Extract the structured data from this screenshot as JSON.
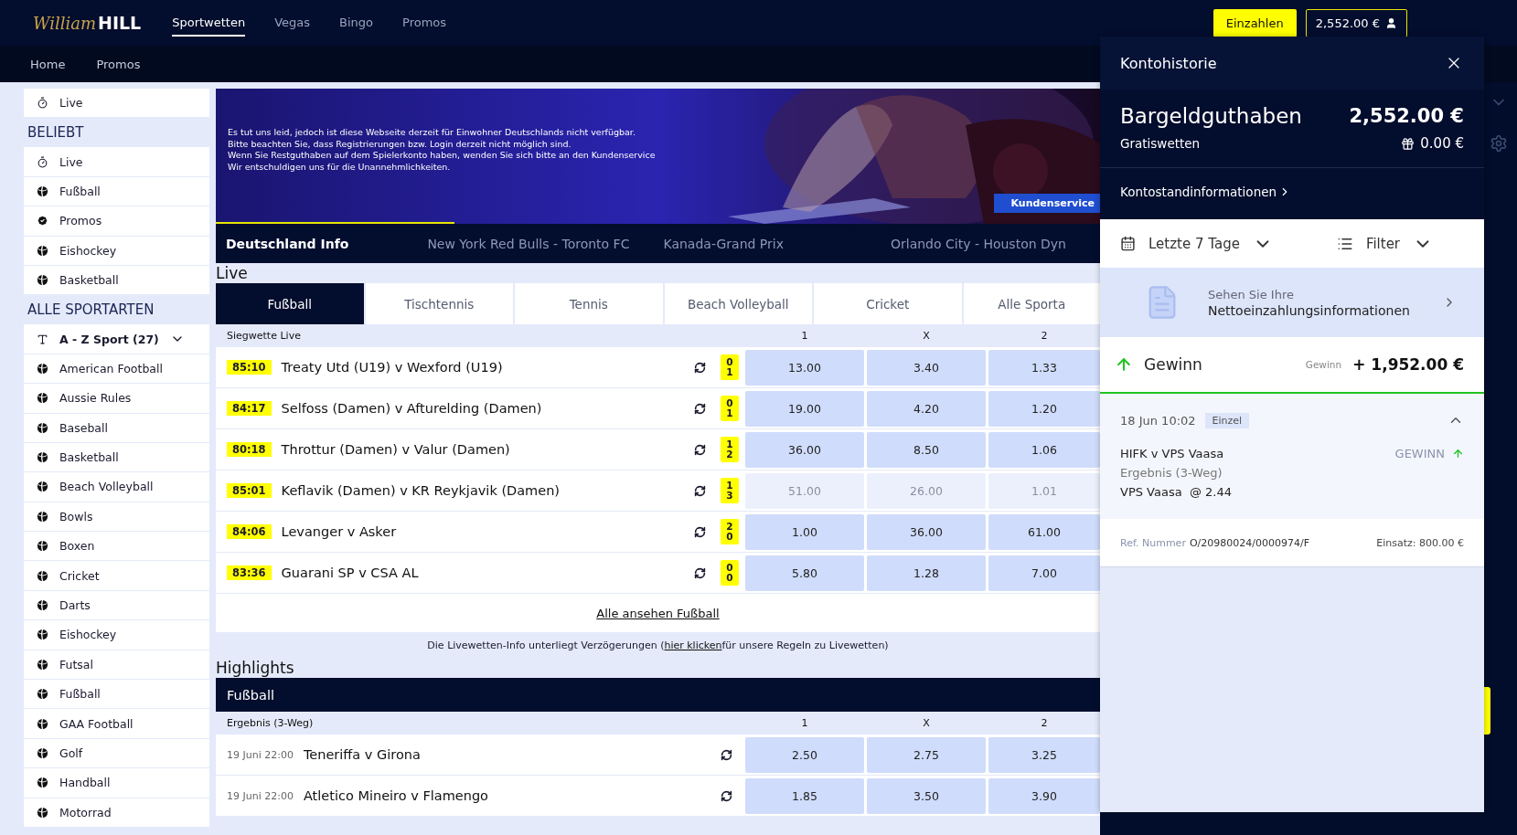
{
  "header": {
    "logo": {
      "script": "William",
      "bold": "HILL"
    },
    "nav": [
      {
        "label": "Sportwetten",
        "selected": true
      },
      {
        "label": "Vegas",
        "selected": false
      },
      {
        "label": "Bingo",
        "selected": false
      },
      {
        "label": "Promos",
        "selected": false
      }
    ],
    "deposit_button": "Einzahlen",
    "balance": "2,552.00 €"
  },
  "subnav": [
    {
      "label": "Home"
    },
    {
      "label": "Promos"
    }
  ],
  "sidebar": {
    "top": [
      {
        "label": "Live",
        "kind": "live"
      }
    ],
    "sections": [
      {
        "title": "BELIEBT",
        "items": [
          {
            "label": "Live",
            "kind": "live"
          },
          {
            "label": "Fußball",
            "kind": "sport"
          },
          {
            "label": "Promos",
            "kind": "promo"
          },
          {
            "label": "Eishockey",
            "kind": "sport"
          },
          {
            "label": "Basketball",
            "kind": "sport"
          }
        ]
      },
      {
        "title": "ALLE SPORTARTEN",
        "items": [
          {
            "label": "A - Z Sport (27)",
            "kind": "group"
          },
          {
            "label": "American Football",
            "kind": "sport"
          },
          {
            "label": "Aussie Rules",
            "kind": "sport"
          },
          {
            "label": "Baseball",
            "kind": "sport"
          },
          {
            "label": "Basketball",
            "kind": "sport"
          },
          {
            "label": "Beach Volleyball",
            "kind": "sport"
          },
          {
            "label": "Bowls",
            "kind": "sport"
          },
          {
            "label": "Boxen",
            "kind": "sport"
          },
          {
            "label": "Cricket",
            "kind": "sport"
          },
          {
            "label": "Darts",
            "kind": "sport"
          },
          {
            "label": "Eishockey",
            "kind": "sport"
          },
          {
            "label": "Futsal",
            "kind": "sport"
          },
          {
            "label": "Fußball",
            "kind": "sport"
          },
          {
            "label": "GAA Football",
            "kind": "sport"
          },
          {
            "label": "Golf",
            "kind": "sport"
          },
          {
            "label": "Handball",
            "kind": "sport"
          },
          {
            "label": "Motorrad",
            "kind": "sport"
          }
        ]
      }
    ]
  },
  "banner": {
    "lines": [
      "Es tut uns leid, jedoch ist diese Webseite derzeit für Einwohner Deutschlands nicht verfügbar.",
      "Bitte beachten Sie, dass Registrierungen bzw. Login derzeit nicht möglich sind.",
      "Wenn Sie Restguthaben auf dem Spielerkonto haben, wenden Sie sich bitte an den Kundenservice",
      "Wir entschuldigen uns für die Unannehmlichkeiten."
    ],
    "button": "Kundenservice",
    "level": 0.27
  },
  "ticker": {
    "title": "Deutschland Info",
    "items": [
      "New York Red Bulls - Toronto FC",
      "Kanada-Grand Prix",
      "Orlando City - Houston Dyn"
    ]
  },
  "live": {
    "title": "Live",
    "tabs": [
      {
        "label": "Fußball",
        "selected": true
      },
      {
        "label": "Tischtennis",
        "selected": false
      },
      {
        "label": "Tennis",
        "selected": false
      },
      {
        "label": "Beach Volleyball",
        "selected": false
      },
      {
        "label": "Cricket",
        "selected": false
      },
      {
        "label": "Alle Sporta",
        "selected": false
      }
    ],
    "columns": [
      "Siegwette Live",
      "1",
      "X",
      "2"
    ],
    "rows": [
      {
        "time": "85:10",
        "match": "Treaty Utd (U19) v Wexford (U19)",
        "score": [
          "0",
          "1"
        ],
        "odds": [
          "13.00",
          "3.40",
          "1.33"
        ],
        "disabled": false
      },
      {
        "time": "84:17",
        "match": "Selfoss (Damen) v Afturelding (Damen)",
        "score": [
          "0",
          "1"
        ],
        "odds": [
          "19.00",
          "4.20",
          "1.20"
        ],
        "disabled": false
      },
      {
        "time": "80:18",
        "match": "Throttur (Damen) v Valur (Damen)",
        "score": [
          "1",
          "2"
        ],
        "odds": [
          "36.00",
          "8.50",
          "1.06"
        ],
        "disabled": false
      },
      {
        "time": "85:01",
        "match": "Keflavik (Damen) v KR Reykjavik (Damen)",
        "score": [
          "1",
          "3"
        ],
        "odds": [
          "51.00",
          "26.00",
          "1.01"
        ],
        "disabled": true
      },
      {
        "time": "84:06",
        "match": "Levanger v Asker",
        "score": [
          "2",
          "0"
        ],
        "odds": [
          "1.00",
          "36.00",
          "61.00"
        ],
        "disabled": false
      },
      {
        "time": "83:36",
        "match": "Guarani SP v CSA AL",
        "score": [
          "0",
          "0"
        ],
        "odds": [
          "5.80",
          "1.28",
          "7.00"
        ],
        "disabled": false
      }
    ],
    "see_all": "Alle ansehen Fußball",
    "notice": {
      "before": "Die Livewetten-Info unterliegt Verzögerungen (",
      "link": "hier klicken",
      "after": " für unsere Regeln zu Livewetten)"
    }
  },
  "highlights": {
    "title": "Highlights",
    "sport": "Fußball",
    "columns": [
      "Ergebnis (3-Weg)",
      "1",
      "X",
      "2"
    ],
    "rows": [
      {
        "date": "19 Juni 22:00",
        "match": "Teneriffa v Girona",
        "odds": [
          "2.50",
          "2.75",
          "3.25"
        ]
      },
      {
        "date": "19 Juni 22:00",
        "match": "Atletico Mineiro v Flamengo",
        "odds": [
          "1.85",
          "3.50",
          "3.90"
        ]
      }
    ]
  },
  "account_panel": {
    "title": "Kontohistorie",
    "cash_label": "Bargeldguthaben",
    "cash": "2,552.00 €",
    "free_label": "Gratiswetten",
    "free": "0.00 €",
    "info_link": "Kontostandinformationen",
    "period": "Letzte 7 Tage",
    "filter": "Filter",
    "net_deposit": {
      "line1": "Sehen Sie Ihre",
      "line2": "Nettoeinzahlungsinformationen"
    },
    "entry": {
      "type": "Gewinn",
      "amount_label": "Gewinn",
      "amount": "+ 1,952.00 €",
      "date": "18 Jun 10:02",
      "tag": "Einzel",
      "expanded": true,
      "event": "HIFK v VPS Vaasa",
      "result": "GEWINN",
      "market": "Ergebnis (3-Weg)",
      "selection": "VPS Vaasa  @ 2.44",
      "ref_label": "Ref. Nummer",
      "ref": "O/20980024/0000974/F",
      "stake": "Einsatz: 800.00 €"
    }
  }
}
